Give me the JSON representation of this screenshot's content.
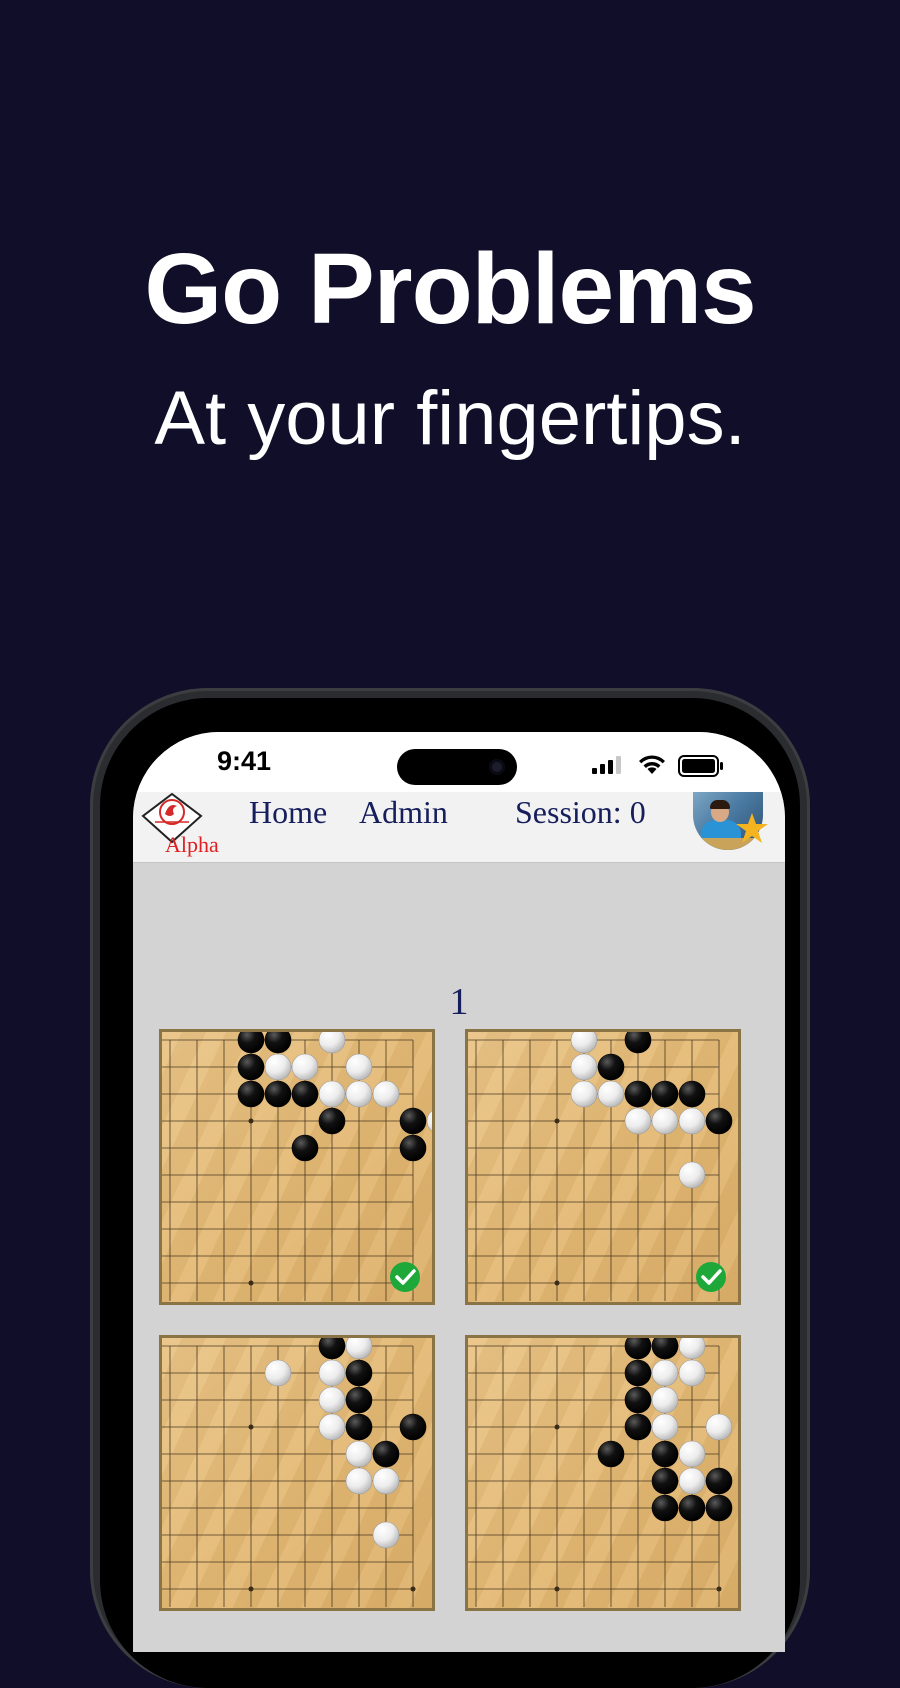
{
  "headline": {
    "title": "Go Problems",
    "subtitle": "At your fingertips."
  },
  "status_bar": {
    "time": "9:41"
  },
  "app_bar": {
    "logo_label": "Alpha",
    "nav": [
      {
        "label": "Home"
      },
      {
        "label": "Admin"
      }
    ],
    "session": "Session: 0"
  },
  "problem_set": {
    "number": "1"
  },
  "colors": {
    "background": "#110e29",
    "nav_text": "#161e5c",
    "logo_label": "#e02020",
    "solved_check": "#1ea83a",
    "board_wood": "#e4b974"
  },
  "problems": [
    {
      "solved": true,
      "black": [
        [
          3,
          0
        ],
        [
          4,
          0
        ],
        [
          3,
          1
        ],
        [
          3,
          2
        ],
        [
          4,
          2
        ],
        [
          5,
          2
        ],
        [
          6,
          3
        ],
        [
          9,
          3
        ],
        [
          5,
          4
        ],
        [
          9,
          4
        ]
      ],
      "white": [
        [
          6,
          0
        ],
        [
          4,
          1
        ],
        [
          5,
          1
        ],
        [
          7,
          1
        ],
        [
          6,
          2
        ],
        [
          7,
          2
        ],
        [
          8,
          2
        ],
        [
          10,
          3
        ]
      ]
    },
    {
      "solved": true,
      "black": [
        [
          6,
          0
        ],
        [
          5,
          1
        ],
        [
          6,
          2
        ],
        [
          7,
          2
        ],
        [
          8,
          2
        ],
        [
          9,
          3
        ]
      ],
      "white": [
        [
          4,
          0
        ],
        [
          4,
          1
        ],
        [
          4,
          2
        ],
        [
          5,
          2
        ],
        [
          6,
          3
        ],
        [
          7,
          3
        ],
        [
          8,
          3
        ],
        [
          8,
          5
        ]
      ]
    },
    {
      "solved": false,
      "black": [
        [
          6,
          0
        ],
        [
          7,
          1
        ],
        [
          7,
          2
        ],
        [
          7,
          3
        ],
        [
          9,
          3
        ],
        [
          8,
          4
        ]
      ],
      "white": [
        [
          7,
          0
        ],
        [
          4,
          1
        ],
        [
          6,
          1
        ],
        [
          6,
          2
        ],
        [
          6,
          3
        ],
        [
          7,
          4
        ],
        [
          7,
          5
        ],
        [
          8,
          5
        ],
        [
          8,
          7
        ]
      ]
    },
    {
      "solved": false,
      "black": [
        [
          6,
          0
        ],
        [
          7,
          0
        ],
        [
          6,
          1
        ],
        [
          6,
          2
        ],
        [
          6,
          3
        ],
        [
          5,
          4
        ],
        [
          7,
          4
        ],
        [
          7,
          5
        ],
        [
          9,
          5
        ],
        [
          7,
          6
        ],
        [
          8,
          6
        ],
        [
          9,
          6
        ]
      ],
      "white": [
        [
          8,
          0
        ],
        [
          7,
          1
        ],
        [
          8,
          1
        ],
        [
          7,
          2
        ],
        [
          7,
          3
        ],
        [
          9,
          3
        ],
        [
          8,
          4
        ],
        [
          8,
          5
        ]
      ]
    }
  ]
}
